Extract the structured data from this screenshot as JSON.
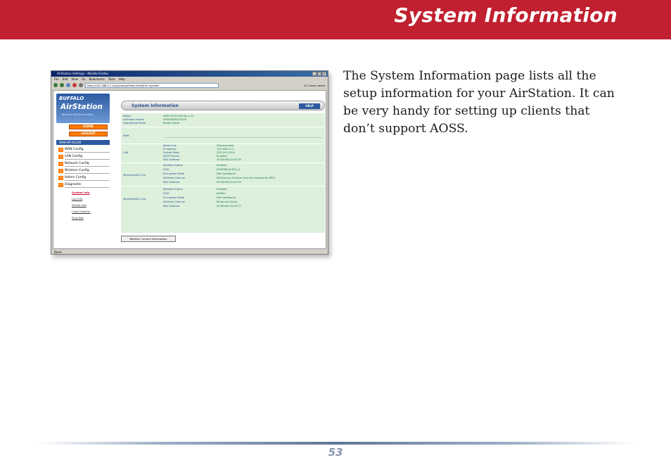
{
  "header": {
    "title": "System Information"
  },
  "body": {
    "paragraph": "The System Information page lists all the setup information for your AirStation.  It can be very handy for setting up clients that don’t support AOSS."
  },
  "footer": {
    "page_number": "53"
  },
  "screenshot": {
    "window_title": "AirStation Settings - Mozilla Firefox",
    "menu": [
      "File",
      "Edit",
      "View",
      "Go",
      "Bookmarks",
      "Tools",
      "Help"
    ],
    "url": "http://192.168.11.1/cgi-bin/cgi?req=frm&frm=sysinfo",
    "toolbar_right": "4.2 hours saved",
    "status": "Done",
    "sidebar": {
      "logo_brand": "BUFFALO",
      "logo_product": "AirStation",
      "logo_sub": "Wireless LAN Access Point",
      "home": "HOME",
      "logout": "LOGOUT",
      "model": "WHR-HP-AG108",
      "menu": [
        "WAN Config",
        "LAN Config",
        "Network Config",
        "Wireless Config",
        "Admin Config",
        "Diagnostic"
      ],
      "submenu": [
        "System Info",
        "Log Info",
        "Packet Info",
        "Client Monitor",
        "Ping Test"
      ]
    },
    "panel": {
      "title": "System Information",
      "help": "HELP",
      "refresh": "Refresh Current Information",
      "top": [
        {
          "label": "Model",
          "value": "WHR-HP-AG108 Ver.1.32"
        },
        {
          "label": "AirStation Name",
          "value": "AP000D0BCA1E26"
        },
        {
          "label": "Operational Mode",
          "value": "Router Mode"
        }
      ],
      "wan": {
        "section": "WAN"
      },
      "lan": {
        "section": "LAN",
        "rows": [
          {
            "label": "Wired Link",
            "value": "Disconnected"
          },
          {
            "label": "IP Address",
            "value": "192.168.11.1"
          },
          {
            "label": "Subnet Mask",
            "value": "255.255.255.0"
          },
          {
            "label": "DHCP Server",
            "value": "Enabled"
          },
          {
            "label": "MAC Address",
            "value": "00:0D:0B:CA:1E:C6"
          }
        ]
      },
      "wireless_a": {
        "section": "Wireless(802.11a)",
        "rows": [
          {
            "label": "Wireless Status",
            "value": "Enabled"
          },
          {
            "label": "SSID",
            "value": "000D0BCA1ECA_A"
          },
          {
            "label": "Encryption Mode",
            "value": "Not Configured"
          },
          {
            "label": "Wireless Channel",
            "value": "64Channel (Channel may be changed by DFS)"
          },
          {
            "label": "MAC Address",
            "value": "00:0D:0B:CA:1E:C8"
          }
        ]
      },
      "wireless_g": {
        "section": "Wireless(802.11g)",
        "rows": [
          {
            "label": "Wireless Status",
            "value": "Enabled"
          },
          {
            "label": "SSID",
            "value": "buffalo"
          },
          {
            "label": "Encryption Mode",
            "value": "Not Configured"
          },
          {
            "label": "Wireless Channel",
            "value": "6Channel (Auto)"
          },
          {
            "label": "MAC Address",
            "value": "00:0D:0B:CA:1E:C7"
          }
        ]
      }
    }
  }
}
